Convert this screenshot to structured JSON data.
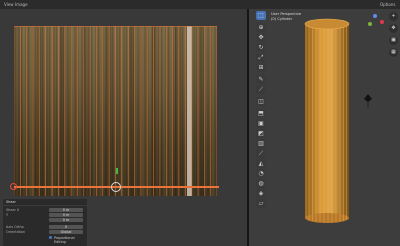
{
  "menu": {
    "view": "View",
    "image": "Image",
    "options": "Options"
  },
  "viewport": {
    "mode": "User Perspective",
    "object": "(0) Cylinder"
  },
  "panel": {
    "title": "Shear",
    "rows": [
      {
        "label": "Shear X",
        "value": "0 m"
      },
      {
        "label": "Y",
        "value": "0 m"
      },
      {
        "label": "",
        "value": "0 m"
      },
      {
        "label": "Axis Ortho",
        "value": "X"
      },
      {
        "label": "Orientation",
        "value": "Global"
      }
    ],
    "proportional_label": "Proportional Editing"
  },
  "colors": {
    "uv_edge": "#e8743b",
    "select": "#4772b3",
    "mesh": "#d9902a"
  },
  "icons": [
    "cursor-icon",
    "move-icon",
    "rotate-icon",
    "scale-icon",
    "transform-icon",
    "annotate-icon",
    "measure-icon",
    "add-cube-icon",
    "extrude-icon",
    "inset-icon",
    "bevel-icon",
    "loopcut-icon",
    "knife-icon",
    "polybuild-icon",
    "spin-icon",
    "smooth-icon",
    "edge-slide-icon",
    "shrink-icon",
    "shear-icon",
    "rip-icon"
  ]
}
